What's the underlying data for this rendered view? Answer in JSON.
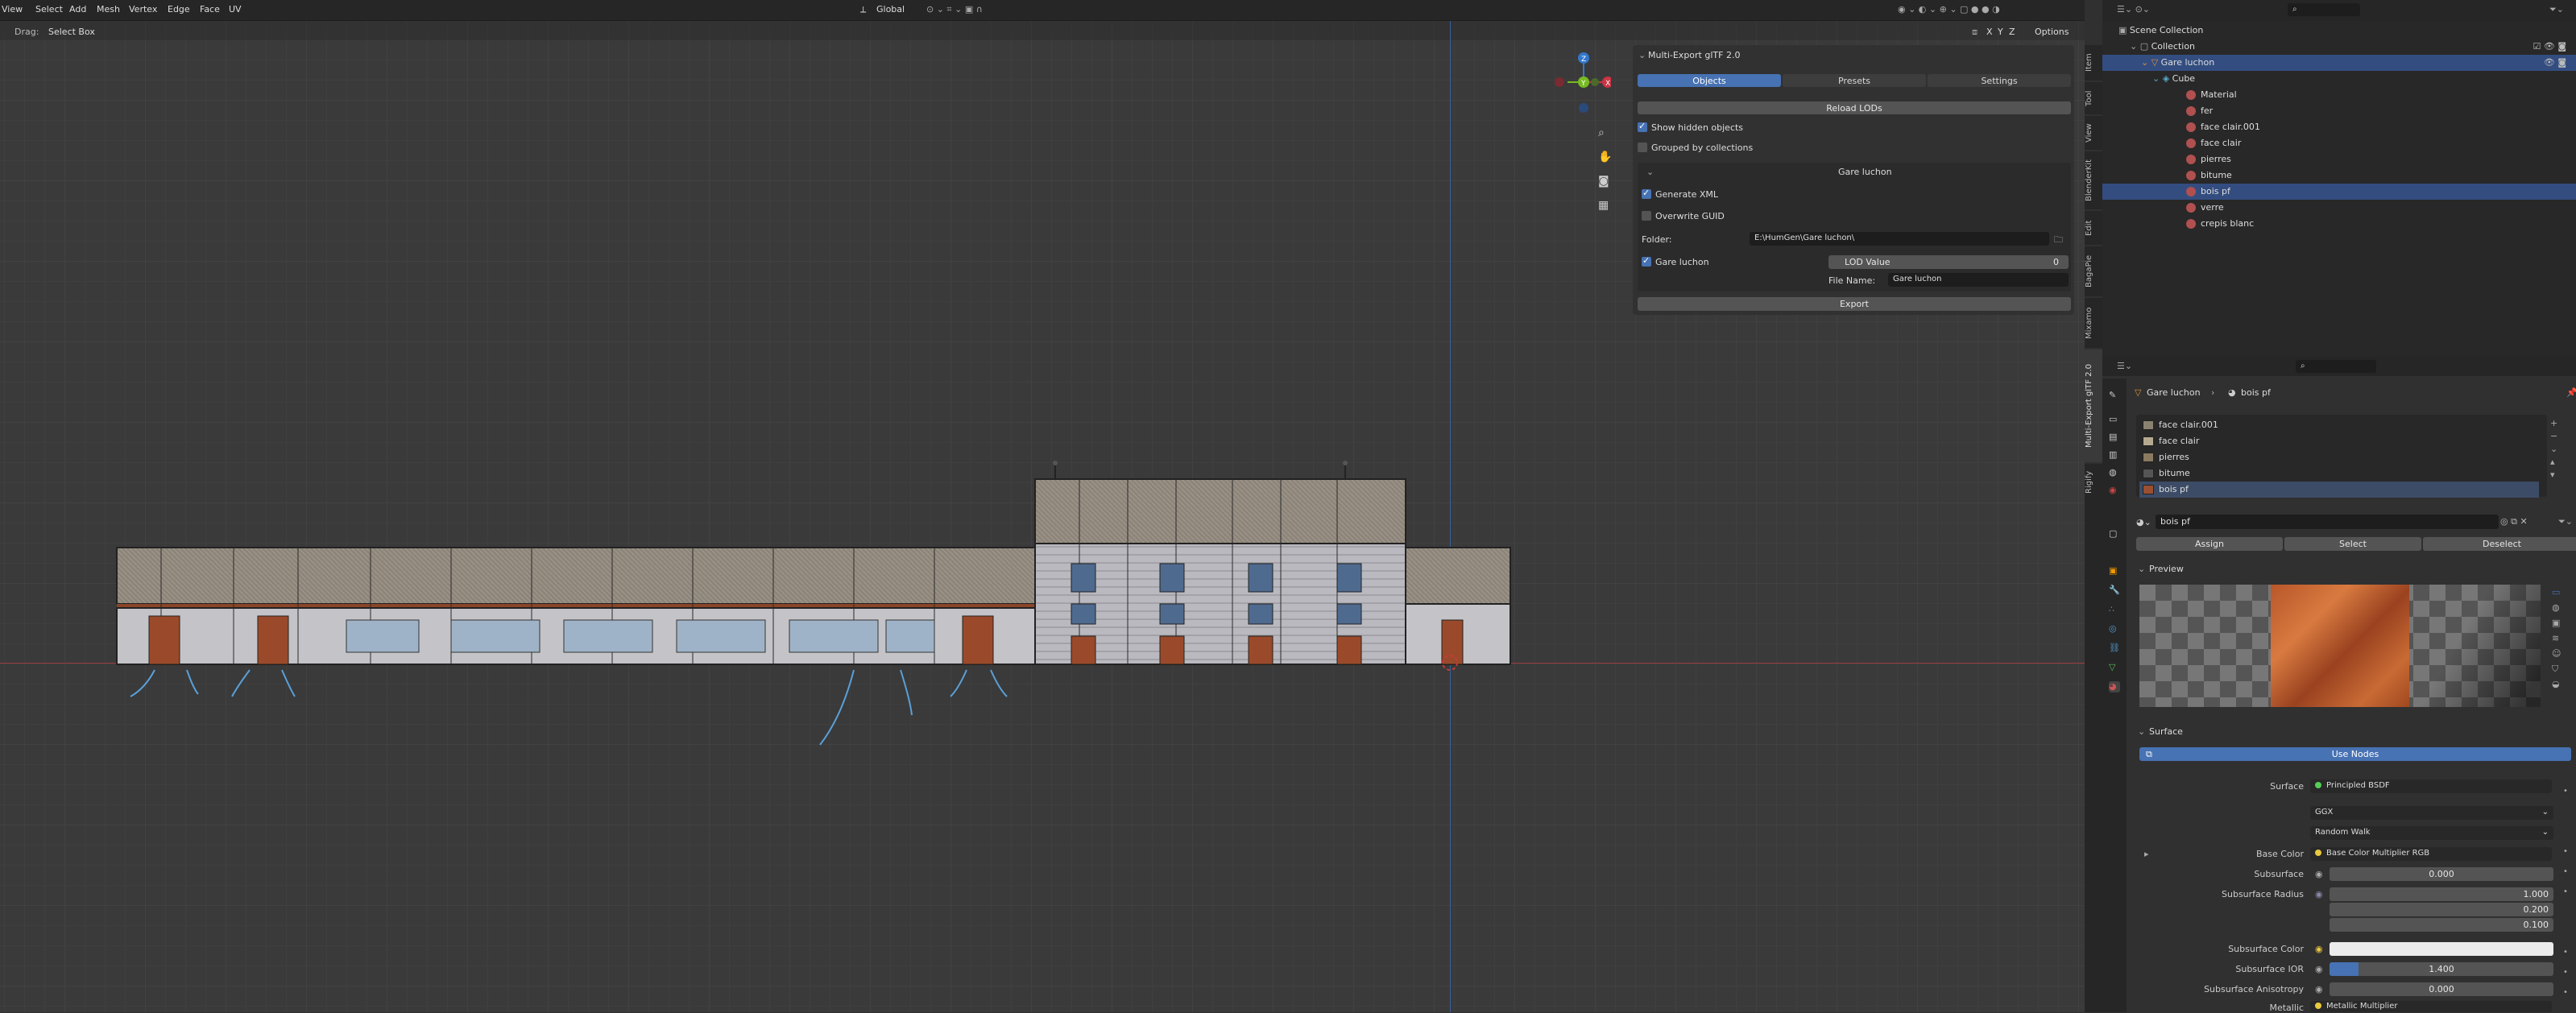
{
  "header": {
    "menus": [
      "View",
      "Select",
      "Add",
      "Mesh",
      "Vertex",
      "Edge",
      "Face",
      "UV"
    ],
    "orientation": "Global",
    "options": "Options",
    "drag_label": "Drag:",
    "drag_value": "Select Box",
    "axes": [
      "X",
      "Y",
      "Z"
    ]
  },
  "panel": {
    "title": "Multi-Export glTF 2.0",
    "tabs": [
      "Objects",
      "Presets",
      "Settings"
    ],
    "reload": "Reload LODs",
    "show_hidden": "Show hidden objects",
    "grouped": "Grouped by collections",
    "group_title": "Gare luchon",
    "generate_xml": "Generate XML",
    "overwrite_guid": "Overwrite GUID",
    "folder_label": "Folder:",
    "folder_value": "E:\\HumGen\\Gare luchon\\",
    "object_name": "Gare luchon",
    "lod_label": "LOD Value",
    "lod_value": "0",
    "file_name_label": "File Name:",
    "file_name_value": "Gare luchon",
    "export": "Export"
  },
  "side_tabs": [
    "Item",
    "Tool",
    "View",
    "BlenderKit",
    "Edit",
    "BagaPie",
    "Mixamo",
    "Multi-Export glTF 2.0",
    "Rigify"
  ],
  "outliner": {
    "rows": [
      "Scene Collection",
      "Collection",
      "Gare luchon",
      "Cube",
      "Material",
      "fer",
      "face clair.001",
      "face clair",
      "pierres",
      "bitume",
      "bois pf",
      "verre",
      "crepis blanc"
    ],
    "selected": "bois pf"
  },
  "props": {
    "breadcrumb_obj": "Gare luchon",
    "breadcrumb_mat": "bois pf",
    "slots": [
      {
        "name": "face clair.001",
        "color": "#8a8270"
      },
      {
        "name": "face clair",
        "color": "#b5aa90"
      },
      {
        "name": "pierres",
        "color": "#8a7a60"
      },
      {
        "name": "bitume",
        "color": "#555555"
      },
      {
        "name": "bois pf",
        "color": "#9a5030"
      }
    ],
    "material_name": "bois pf",
    "assign": "Assign",
    "select": "Select",
    "deselect": "Deselect",
    "preview": "Preview",
    "surface_section": "Surface",
    "use_nodes": "Use Nodes",
    "rows": [
      {
        "label": "Surface",
        "value": "Principled BSDF"
      },
      {
        "label": "",
        "value": "GGX"
      },
      {
        "label": "",
        "value": "Random Walk"
      },
      {
        "label": "Base Color",
        "value": "Base Color Multiplier RGB"
      },
      {
        "label": "Subsurface",
        "value": "0.000"
      },
      {
        "label": "Subsurface Radius",
        "value": "1.000"
      },
      {
        "label": "",
        "value": "0.200"
      },
      {
        "label": "",
        "value": "0.100"
      },
      {
        "label": "Subsurface Color",
        "value": ""
      },
      {
        "label": "Subsurface IOR",
        "value": "1.400"
      },
      {
        "label": "Subsurface Anisotropy",
        "value": "0.000"
      },
      {
        "label": "Metallic",
        "value": "Metallic Multiplier"
      }
    ]
  },
  "colors": {
    "accent": "#4772b3",
    "selected_row": "#334d80",
    "x_axis": "#cc3344",
    "y_axis": "#77bb22",
    "z_axis": "#3377cc"
  }
}
